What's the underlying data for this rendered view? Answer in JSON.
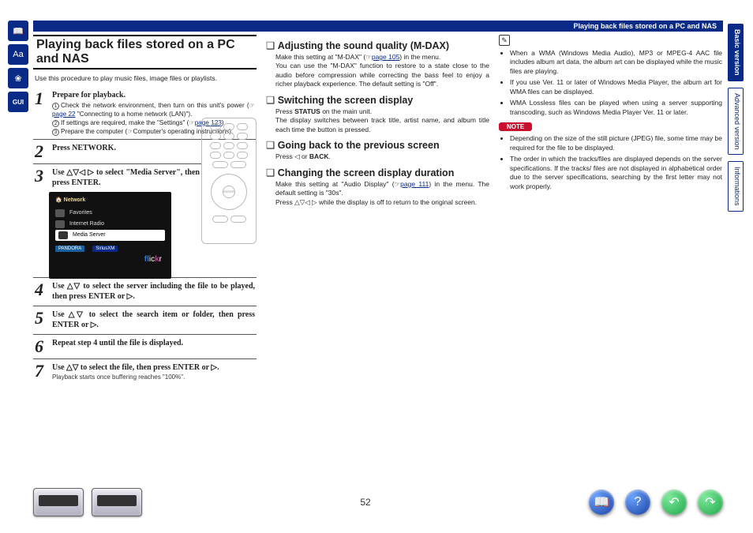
{
  "topbar": {
    "title": "Playing back files stored on a PC and NAS"
  },
  "sidebar_icons": [
    "book-icon",
    "aa-icon",
    "shell-icon",
    "gui-icon"
  ],
  "tabs": [
    {
      "label": "Basic version",
      "active": true
    },
    {
      "label": "Advanced version",
      "active": false
    },
    {
      "label": "Informations",
      "active": false
    }
  ],
  "col1": {
    "title": "Playing back files stored on a PC and NAS",
    "intro": "Use this procedure to play music files, image files or playlists.",
    "step1": {
      "head": "Prepare for playback.",
      "l1a": "Check the network environment, then turn on this unit's power (",
      "l1link": "page 22",
      "l1b": " \"Connecting to a home network (LAN)\").",
      "l2a": "If settings are required, make the \"Settings\" (",
      "l2link": "page 123",
      "l2b": ").",
      "l3a": "Prepare the computer (",
      "l3b": "Computer's operating instructions)."
    },
    "step2": {
      "text": "Press NETWORK."
    },
    "step3": {
      "text": "Use △▽◁ ▷ to select \"Media Server\", then press ENTER."
    },
    "step4": {
      "text": "Use △▽ to select the server including the file to be played, then press ENTER or ▷."
    },
    "step5": {
      "text": "Use △▽ to select the search item or folder, then press ENTER or ▷."
    },
    "step6": {
      "text": "Repeat step 4 until the file is displayed."
    },
    "step7": {
      "text": "Use △▽ to select the file, then press ENTER or ▷.",
      "sub": "Playback starts once buffering reaches \"100%\"."
    },
    "screen": {
      "head": "Network",
      "rows": [
        "Favorites",
        "Internet Radio",
        "Media Server"
      ],
      "flickr": "flickr",
      "pandora": "PANDORA",
      "sirius": "SiriusXM"
    },
    "remote": {
      "enter": "ENTER"
    }
  },
  "col2": {
    "s1": {
      "head": "Adjusting the sound quality (M-DAX)",
      "b1a": "Make this setting at \"M-DAX\" (",
      "b1link": "page 105",
      "b1b": ") in the menu.",
      "b2": "You can use the \"M-DAX\" function to restore to a state close to the audio before compression while correcting the bass feel to enjoy a richer playback experience. The default setting is \"Off\"."
    },
    "s2": {
      "head": "Switching the screen display",
      "b1": "Press STATUS on the main unit.",
      "b2": "The display switches between track title, artist name, and album title each time the button is pressed."
    },
    "s3": {
      "head": "Going back to the previous screen",
      "b1": "Press ◁ or BACK."
    },
    "s4": {
      "head": "Changing the screen display duration",
      "b1a": "Make this setting at \"Audio Display\" (",
      "b1link": "page 111",
      "b1b": ") in the menu. The default setting is \"30s\".",
      "b2": "Press △▽◁ ▷ while the display is off to return to the original screen."
    }
  },
  "col3": {
    "bullets_top": [
      "When a WMA (Windows Media Audio), MP3 or MPEG-4 AAC file includes album art data, the album art can be displayed while the music files are playing.",
      "If you use Ver. 11 or later of Windows Media Player, the album art for WMA files can be displayed.",
      "WMA Lossless files can be played when using a server supporting transcoding, such as Windows Media Player Ver. 11 or later."
    ],
    "note_label": "NOTE",
    "bullets_note": [
      "Depending on the size of the still picture (JPEG) file, some time may be required for the file to be displayed.",
      "The order in which the tracks/files are displayed depends on the server specifications. If the tracks/ files are not displayed in alphabetical order due to the server specifications, searching by the first letter may not work properly."
    ]
  },
  "footer": {
    "pagenum": "52"
  }
}
